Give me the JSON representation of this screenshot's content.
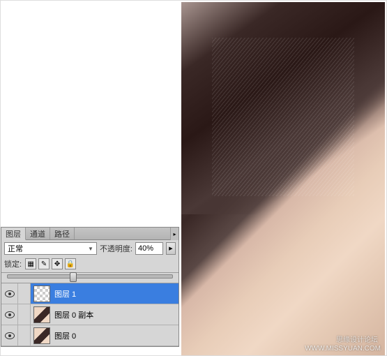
{
  "panel": {
    "tabs": {
      "layers": "图层",
      "channels": "通道",
      "paths": "路径"
    },
    "blend": {
      "mode": "正常",
      "opacity_label": "不透明度:",
      "opacity_value": "40%"
    },
    "lock": {
      "label": "锁定:"
    },
    "layers": [
      {
        "name": "图层 1",
        "selected": true,
        "thumb": "checker"
      },
      {
        "name": "图层 0 副本",
        "selected": false,
        "thumb": "photo"
      },
      {
        "name": "图层 0",
        "selected": false,
        "thumb": "photo"
      }
    ]
  },
  "photo": {
    "watermark_main": "思缘设计论坛",
    "watermark_url": "WWW.MISSYUAN.COM"
  }
}
